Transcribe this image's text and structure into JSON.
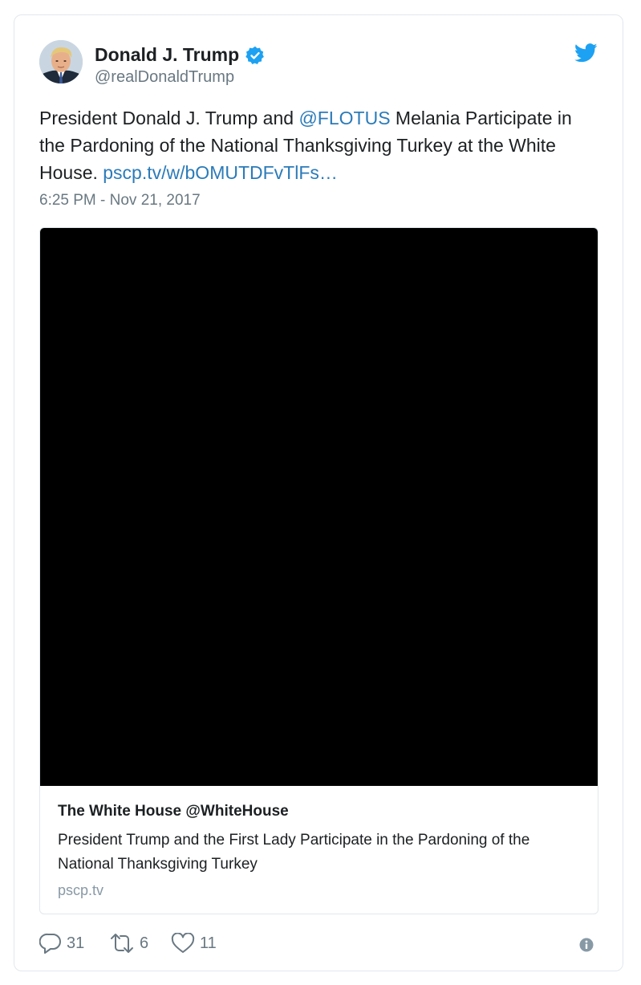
{
  "tweet": {
    "author": {
      "name": "Donald J. Trump",
      "handle": "@realDonaldTrump",
      "verified": true,
      "avatar_icon": "profile-photo"
    },
    "brand_icon": "twitter-bird-icon",
    "text": {
      "part1": "President Donald J. Trump and ",
      "mention": "@FLOTUS",
      "part2": " Melania Participate in the Pardoning of the National Thanksgiving Turkey at the White House. ",
      "link": "pscp.tv/w/bOMUTDFvTlFs…"
    },
    "timestamp": "6:25 PM - Nov 21, 2017",
    "card": {
      "title": "The White House @WhiteHouse",
      "description": "President Trump and the First Lady Participate in the Pardoning of the National Thanksgiving Turkey",
      "domain": "pscp.tv"
    },
    "actions": {
      "replies": "31",
      "retweets": "6",
      "likes": "11"
    },
    "colors": {
      "link": "#2b7bb9",
      "twitter_blue": "#1da1f2",
      "meta_gray": "#697882",
      "border": "#e1e8ed"
    }
  }
}
